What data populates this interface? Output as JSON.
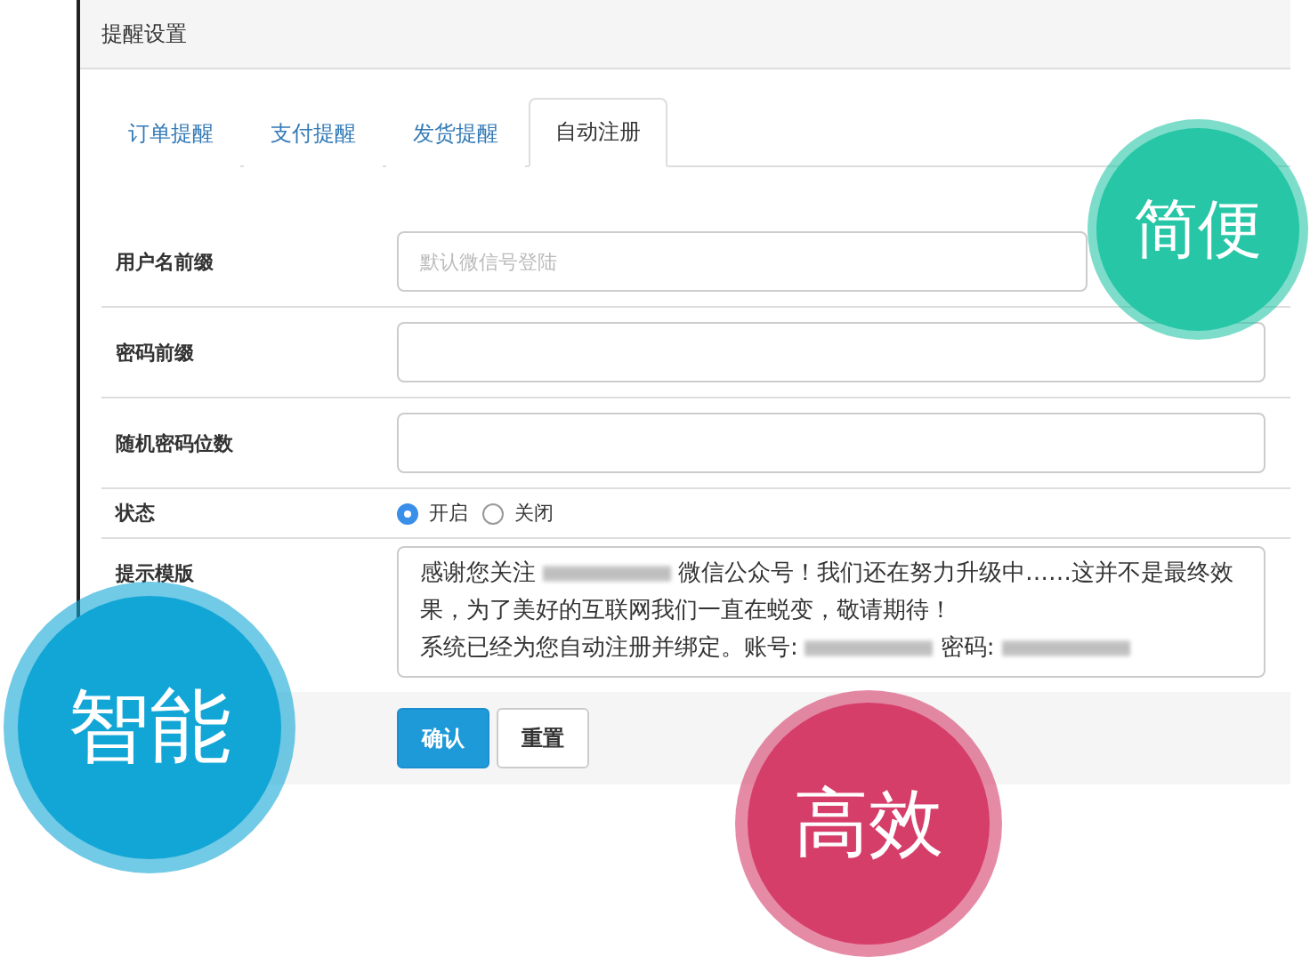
{
  "panel": {
    "title": "提醒设置"
  },
  "tabs": [
    {
      "label": "订单提醒",
      "selected": false
    },
    {
      "label": "支付提醒",
      "selected": false
    },
    {
      "label": "发货提醒",
      "selected": false
    },
    {
      "label": "自动注册",
      "selected": true
    }
  ],
  "form": {
    "rows": [
      {
        "kind": "input",
        "label": "用户名前缀",
        "placeholder": "默认微信号登陆"
      },
      {
        "kind": "input",
        "label": "密码前缀"
      },
      {
        "kind": "input",
        "label": "随机密码位数"
      },
      {
        "kind": "radio",
        "label": "状态",
        "options": [
          {
            "label": "开启",
            "selected": true
          },
          {
            "label": "关闭",
            "selected": false
          }
        ]
      },
      {
        "kind": "textarea",
        "label": "提示模版",
        "lines": [
          [
            {
              "kind": "text",
              "text": "感谢您关注"
            },
            {
              "kind": "redacted"
            },
            {
              "kind": "text",
              "text": "微信公众号！我们还在努力升级中……这并不是最终效"
            }
          ],
          [
            {
              "kind": "text",
              "text": "果，为了美好的互联网我们一直在蜕变，敬请期待！"
            }
          ],
          [
            {
              "kind": "text",
              "text": "系统已经为您自动注册并绑定。账号:"
            },
            {
              "kind": "redacted"
            },
            {
              "kind": "text",
              "text": "密码:"
            },
            {
              "kind": "redacted"
            }
          ]
        ]
      }
    ]
  },
  "buttons": [
    {
      "label": "确认",
      "kind": "primary"
    },
    {
      "label": "重置",
      "kind": "default"
    }
  ],
  "badges": [
    {
      "label": "简便",
      "color": "#26c6a6"
    },
    {
      "label": "智能",
      "color": "#12a6d6"
    },
    {
      "label": "高效",
      "color": "#d63e6a"
    }
  ]
}
